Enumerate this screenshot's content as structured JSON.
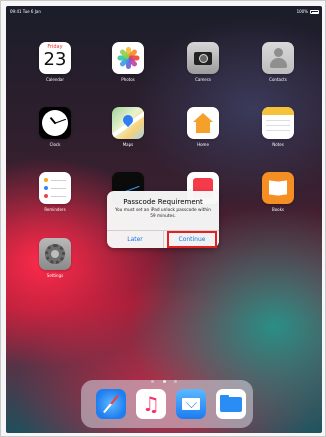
{
  "status_bar": {
    "time": "09:41  Tue 6 Jan",
    "battery": "100%"
  },
  "apps": {
    "calendar": {
      "label": "Calendar",
      "day": "Friday",
      "date": "23"
    },
    "photos": {
      "label": "Photos"
    },
    "camera": {
      "label": "Camera"
    },
    "contacts": {
      "label": "Contacts"
    },
    "clock": {
      "label": "Clock"
    },
    "maps": {
      "label": "Maps"
    },
    "home": {
      "label": "Home"
    },
    "notes": {
      "label": "Notes"
    },
    "reminders": {
      "label": "Reminders"
    },
    "books": {
      "label": "Books"
    },
    "settings": {
      "label": "Settings"
    }
  },
  "alert": {
    "title": "Passcode Requirement",
    "message": "You must set an iPad unlock passcode within 59 minutes.",
    "later_label": "Later",
    "continue_label": "Continue"
  },
  "colors": {
    "accent_blue": "#1a73e8",
    "highlight_red": "#e32121"
  },
  "icons": [
    "battery-icon",
    "calendar-icon",
    "photos-icon",
    "camera-icon",
    "contacts-icon",
    "clock-icon",
    "maps-icon",
    "home-icon",
    "notes-icon",
    "reminders-icon",
    "stocks-icon",
    "news-icon",
    "books-icon",
    "settings-icon",
    "safari-icon",
    "music-icon",
    "mail-icon",
    "files-icon"
  ]
}
